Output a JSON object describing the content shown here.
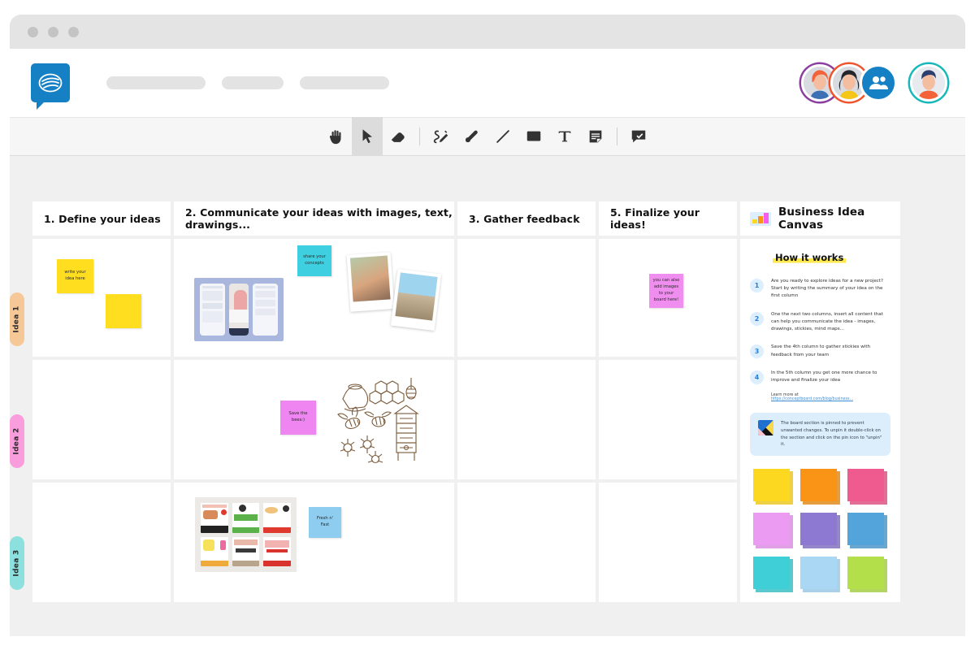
{
  "window": {
    "dots": 3
  },
  "header": {
    "logo_name": "conceptboard-logo",
    "nav_pills": 3,
    "avatars": [
      {
        "name": "avatar-user-1",
        "ring": "#8a3fa0"
      },
      {
        "name": "avatar-user-2",
        "ring": "#f0542d"
      },
      {
        "name": "add-people-button",
        "ring": "#1580c4"
      },
      {
        "name": "avatar-current-user",
        "ring": "#17b7ba"
      }
    ]
  },
  "toolbar": {
    "tools": [
      {
        "name": "hand-tool",
        "icon": "hand",
        "active": false
      },
      {
        "name": "select-tool",
        "icon": "cursor",
        "active": true
      },
      {
        "name": "eraser-tool",
        "icon": "eraser",
        "active": false
      },
      {
        "name": "divider-1",
        "icon": "divider",
        "active": false
      },
      {
        "name": "pen-tool",
        "icon": "pen",
        "active": false
      },
      {
        "name": "highlighter-tool",
        "icon": "highlighter",
        "active": false
      },
      {
        "name": "line-tool",
        "icon": "line",
        "active": false
      },
      {
        "name": "shapes-tool",
        "icon": "shapes",
        "active": false
      },
      {
        "name": "text-tool",
        "icon": "text",
        "active": false
      },
      {
        "name": "sticky-note-tool",
        "icon": "note",
        "active": false
      },
      {
        "name": "divider-2",
        "icon": "divider",
        "active": false
      },
      {
        "name": "comment-tool",
        "icon": "comment",
        "active": false
      }
    ]
  },
  "board": {
    "columns": [
      {
        "label": "1. Define your ideas"
      },
      {
        "label": "2. Communicate your ideas with images, text, drawings..."
      },
      {
        "label": "3. Gather feedback"
      },
      {
        "label": "5. Finalize your ideas!"
      },
      {
        "label": "Business Idea Canvas"
      }
    ],
    "rows": [
      {
        "label": "Idea 1",
        "color": "#f6c898"
      },
      {
        "label": "Idea 2",
        "color": "#f99ddd"
      },
      {
        "label": "Idea 3",
        "color": "#8ce0de"
      }
    ],
    "stickies": [
      {
        "name": "sticky-write-idea",
        "text": "write your idea here",
        "color": "#ffdd1f"
      },
      {
        "name": "sticky-blank-yellow",
        "text": "",
        "color": "#ffdd1f"
      },
      {
        "name": "sticky-share",
        "text": "share your concepts",
        "color": "#3ed0e0"
      },
      {
        "name": "sticky-bees",
        "text": "Save the bees:)",
        "color": "#ee85f0"
      },
      {
        "name": "sticky-fresh",
        "text": "Fresh n' Fast",
        "color": "#8ecdf0"
      },
      {
        "name": "sticky-add-images",
        "text": "you can also add images to your board here!",
        "color": "#f08ef0"
      }
    ]
  },
  "panel": {
    "title": "How it works",
    "steps": [
      {
        "num": "1",
        "text": "Are you ready to explore ideas for a new project? Start by writing the summary of your idea on the first column"
      },
      {
        "num": "2",
        "text": "One the next two columns, insert all content that can help you communicate the idea - images, drawings, stickies, mind maps..."
      },
      {
        "num": "3",
        "text": "Save the 4th column to gather stickies with feedback from your team"
      },
      {
        "num": "4",
        "text": "In the 5th column you get one more chance to improve and finalize your idea"
      }
    ],
    "learn_more_label": "Learn more at",
    "learn_more_link": "https://conceptboard.com/blog/business...",
    "pin_notice": "The board section is pinned to prevent unwanted changes. To unpin it double-click on the section and click on the pin icon to \"unpin\" it.",
    "swatches": [
      {
        "name": "swatch-yellow",
        "color": "#fdd821"
      },
      {
        "name": "swatch-orange",
        "color": "#f99417"
      },
      {
        "name": "swatch-pink",
        "color": "#ef5b8e"
      },
      {
        "name": "swatch-violet",
        "color": "#eb9cf2"
      },
      {
        "name": "swatch-purple",
        "color": "#8d79d1"
      },
      {
        "name": "swatch-blue",
        "color": "#52a4da"
      },
      {
        "name": "swatch-teal",
        "color": "#3ed0d6"
      },
      {
        "name": "swatch-lightblue",
        "color": "#a9d7f4"
      },
      {
        "name": "swatch-green",
        "color": "#b3e04a"
      }
    ]
  },
  "images": [
    {
      "name": "image-app-mockup",
      "caption": "mobile app screens mockup"
    },
    {
      "name": "image-polaroids",
      "caption": "two polaroid photos"
    },
    {
      "name": "image-bees",
      "caption": "vintage bee and beehive illustrations"
    },
    {
      "name": "image-food-posters",
      "caption": "food flyer poster collage"
    }
  ]
}
